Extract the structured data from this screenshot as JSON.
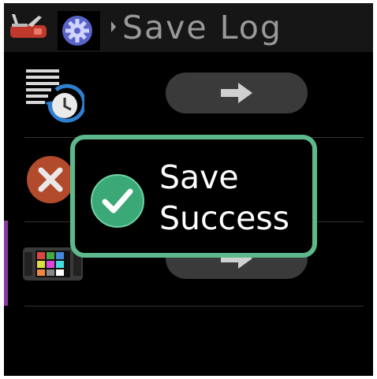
{
  "header": {
    "title": "Save Log",
    "app_icon": "multitool-icon",
    "settings_icon": "gear-icon",
    "breadcrumb_icon": "chevron-right-icon"
  },
  "rows": [
    {
      "icon": "log-history-icon",
      "action_icon": "arrow-right-icon"
    },
    {
      "icon": "delete-icon"
    },
    {
      "icon": "camera-color-grid-icon",
      "action_icon": "arrow-right-icon"
    }
  ],
  "toast": {
    "line1": "Save",
    "line2": "Success",
    "icon": "check-circle-icon"
  },
  "colors": {
    "toast_border": "#5db98b",
    "check_fill": "#3aa877",
    "delete_fill": "#b24a2c",
    "gear_fill": "#5a64c8",
    "accent": "#8a3aa0"
  }
}
